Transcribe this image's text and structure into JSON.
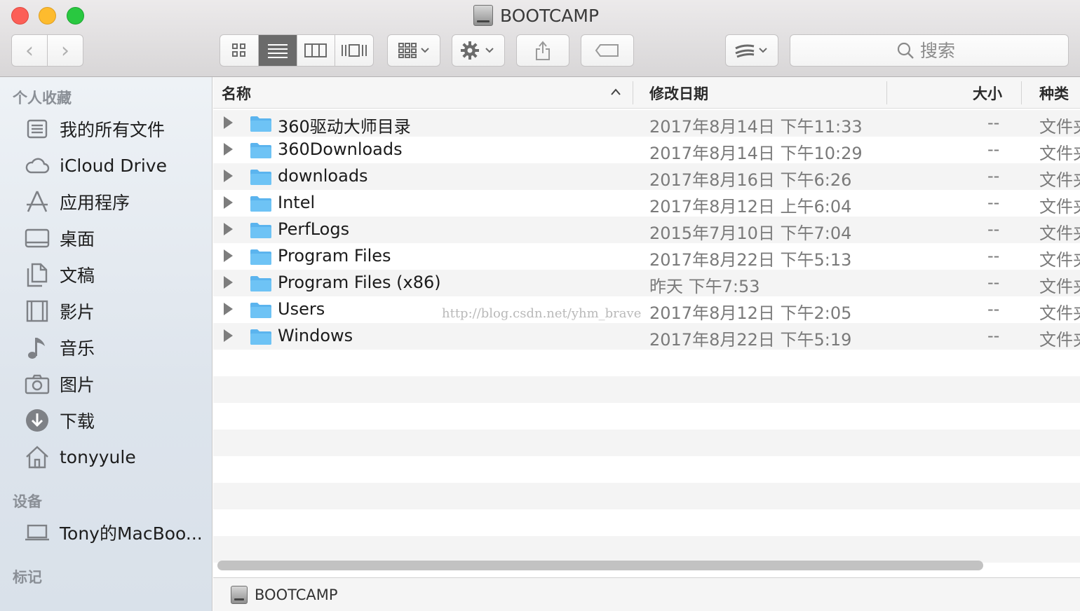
{
  "window": {
    "title": "BOOTCAMP"
  },
  "toolbar": {
    "search_placeholder": "搜索"
  },
  "sidebar": {
    "sections": {
      "favorites": "个人收藏",
      "devices": "设备",
      "tags": "标记"
    },
    "favorites": [
      {
        "label": "我的所有文件",
        "icon": "all-files-icon"
      },
      {
        "label": "iCloud Drive",
        "icon": "cloud-icon"
      },
      {
        "label": "应用程序",
        "icon": "applications-icon"
      },
      {
        "label": "桌面",
        "icon": "desktop-icon"
      },
      {
        "label": "文稿",
        "icon": "documents-icon"
      },
      {
        "label": "影片",
        "icon": "movies-icon"
      },
      {
        "label": "音乐",
        "icon": "music-icon"
      },
      {
        "label": "图片",
        "icon": "camera-icon"
      },
      {
        "label": "下载",
        "icon": "download-icon"
      },
      {
        "label": "tonyyule",
        "icon": "home-icon"
      }
    ],
    "devices": [
      {
        "label": "Tony的MacBoo...",
        "icon": "laptop-icon"
      }
    ]
  },
  "columns": {
    "name": "名称",
    "date": "修改日期",
    "size": "大小",
    "kind": "种类"
  },
  "files": [
    {
      "name": "360驱动大师目录",
      "date": "2017年8月14日 下午11:33",
      "size": "--",
      "kind": "文件夹"
    },
    {
      "name": "360Downloads",
      "date": "2017年8月14日 下午10:29",
      "size": "--",
      "kind": "文件夹"
    },
    {
      "name": "downloads",
      "date": "2017年8月16日 下午6:26",
      "size": "--",
      "kind": "文件夹"
    },
    {
      "name": "Intel",
      "date": "2017年8月12日 上午6:04",
      "size": "--",
      "kind": "文件夹"
    },
    {
      "name": "PerfLogs",
      "date": "2015年7月10日 下午7:04",
      "size": "--",
      "kind": "文件夹"
    },
    {
      "name": "Program Files",
      "date": "2017年8月22日 下午5:13",
      "size": "--",
      "kind": "文件夹"
    },
    {
      "name": "Program Files (x86)",
      "date": "昨天 下午7:53",
      "size": "--",
      "kind": "文件夹"
    },
    {
      "name": "Users",
      "date": "2017年8月12日 下午2:05",
      "size": "--",
      "kind": "文件夹"
    },
    {
      "name": "Windows",
      "date": "2017年8月22日 下午5:19",
      "size": "--",
      "kind": "文件夹"
    }
  ],
  "watermark": "http://blog.csdn.net/yhm_brave",
  "pathbar": {
    "label": "BOOTCAMP"
  },
  "colors": {
    "folder": "#5bb4ee",
    "close": "#fc5f57",
    "minimize": "#fdbb2e",
    "zoom": "#29c840"
  }
}
